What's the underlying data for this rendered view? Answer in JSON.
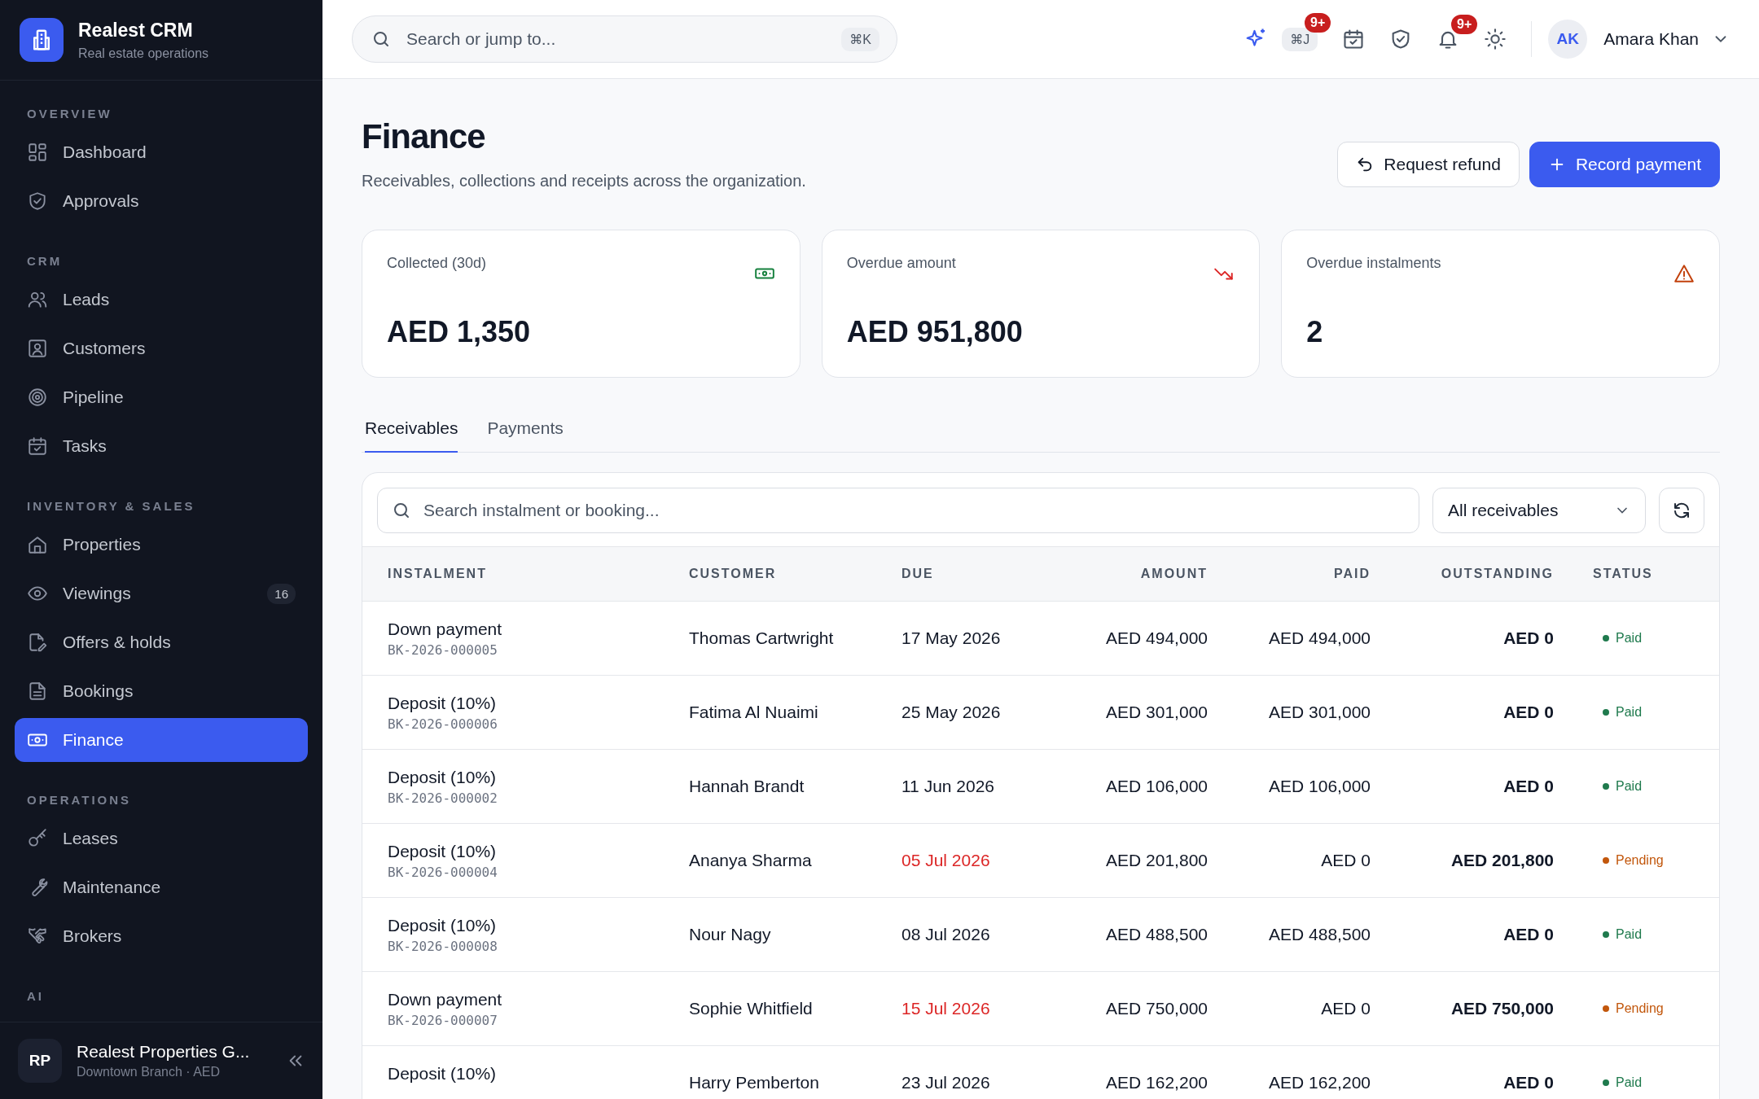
{
  "sidebar": {
    "brand": {
      "title": "Realest CRM",
      "subtitle": "Real estate operations"
    },
    "sections": [
      {
        "label": "OVERVIEW",
        "items": [
          {
            "label": "Dashboard",
            "selected": false
          },
          {
            "label": "Approvals",
            "selected": false
          }
        ]
      },
      {
        "label": "CRM",
        "items": [
          {
            "label": "Leads",
            "selected": false
          },
          {
            "label": "Customers",
            "selected": false
          },
          {
            "label": "Pipeline",
            "selected": false
          },
          {
            "label": "Tasks",
            "selected": false
          }
        ]
      },
      {
        "label": "INVENTORY & SALES",
        "items": [
          {
            "label": "Properties",
            "selected": false
          },
          {
            "label": "Viewings",
            "selected": false,
            "badge": "16"
          },
          {
            "label": "Offers & holds",
            "selected": false
          },
          {
            "label": "Bookings",
            "selected": false
          },
          {
            "label": "Finance",
            "selected": true
          }
        ]
      },
      {
        "label": "OPERATIONS",
        "items": [
          {
            "label": "Leases",
            "selected": false
          },
          {
            "label": "Maintenance",
            "selected": false
          },
          {
            "label": "Brokers",
            "selected": false
          }
        ]
      },
      {
        "label": "AI"
      }
    ],
    "footer": {
      "initials": "RP",
      "name": "Realest Properties G...",
      "subtitle": "Downtown Branch · AED"
    }
  },
  "topbar": {
    "search": {
      "placeholder": "Search or jump to...",
      "shortcut": "⌘K"
    },
    "ai_shortcut": "⌘J",
    "ai_badge": "9+",
    "notifications_badge": "9+",
    "user": {
      "initials": "AK",
      "name": "Amara Khan"
    }
  },
  "page": {
    "title": "Finance",
    "subtitle": "Receivables, collections and receipts across the organization.",
    "actions": [
      {
        "label": "Request refund",
        "kind": "secondary"
      },
      {
        "label": "Record payment",
        "kind": "primary"
      }
    ]
  },
  "stats": [
    {
      "label": "Collected (30d)",
      "value": "AED 1,350",
      "color": "#15803d"
    },
    {
      "label": "Overdue amount",
      "value": "AED 951,800",
      "color": "#dc2626"
    },
    {
      "label": "Overdue instalments",
      "value": "2",
      "color": "#c2410c"
    }
  ],
  "tabs": [
    {
      "label": "Receivables",
      "selected": true
    },
    {
      "label": "Payments",
      "selected": false
    }
  ],
  "table": {
    "search": {
      "placeholder": "Search instalment or booking..."
    },
    "filter": "All receivables",
    "columns": [
      "INSTALMENT",
      "CUSTOMER",
      "DUE",
      "AMOUNT",
      "PAID",
      "OUTSTANDING",
      "STATUS"
    ],
    "rows": [
      {
        "instalment": "Down payment",
        "ref": "BK-2026-000005",
        "customer": "Thomas Cartwright",
        "due": "17 May 2026",
        "overdue": false,
        "amount": "AED 494,000",
        "paid": "AED 494,000",
        "outstanding": "AED 0",
        "status": "Paid",
        "color": "#1f7a4d"
      },
      {
        "instalment": "Deposit (10%)",
        "ref": "BK-2026-000006",
        "customer": "Fatima Al Nuaimi",
        "due": "25 May 2026",
        "overdue": false,
        "amount": "AED 301,000",
        "paid": "AED 301,000",
        "outstanding": "AED 0",
        "status": "Paid",
        "color": "#1f7a4d"
      },
      {
        "instalment": "Deposit (10%)",
        "ref": "BK-2026-000002",
        "customer": "Hannah Brandt",
        "due": "11 Jun 2026",
        "overdue": false,
        "amount": "AED 106,000",
        "paid": "AED 106,000",
        "outstanding": "AED 0",
        "status": "Paid",
        "color": "#1f7a4d"
      },
      {
        "instalment": "Deposit (10%)",
        "ref": "BK-2026-000004",
        "customer": "Ananya Sharma",
        "due": "05 Jul 2026",
        "overdue": true,
        "amount": "AED 201,800",
        "paid": "AED 0",
        "outstanding": "AED 201,800",
        "status": "Pending",
        "color": "#c2570c"
      },
      {
        "instalment": "Deposit (10%)",
        "ref": "BK-2026-000008",
        "customer": "Nour Nagy",
        "due": "08 Jul 2026",
        "overdue": false,
        "amount": "AED 488,500",
        "paid": "AED 488,500",
        "outstanding": "AED 0",
        "status": "Paid",
        "color": "#1f7a4d"
      },
      {
        "instalment": "Down payment",
        "ref": "BK-2026-000007",
        "customer": "Sophie Whitfield",
        "due": "15 Jul 2026",
        "overdue": true,
        "amount": "AED 750,000",
        "paid": "AED 0",
        "outstanding": "AED 750,000",
        "status": "Pending",
        "color": "#c2570c"
      },
      {
        "instalment": "Deposit (10%)",
        "customer": "Harry Pemberton",
        "due": "23 Jul 2026",
        "overdue": false,
        "amount": "AED 162,200",
        "paid": "AED 162,200",
        "outstanding": "AED 0",
        "status": "Paid",
        "color": "#1f7a4d"
      }
    ]
  }
}
